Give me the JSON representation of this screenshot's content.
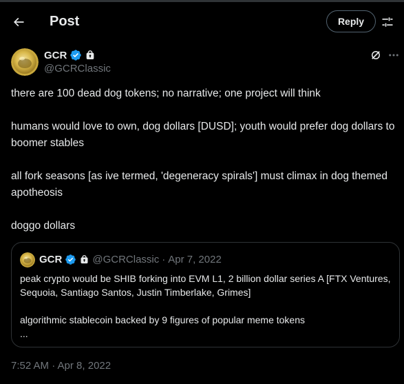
{
  "header": {
    "title": "Post",
    "reply_label": "Reply"
  },
  "tweet": {
    "display_name": "GCR",
    "handle": "@GCRClassic",
    "paragraphs": [
      "there are 100 dead dog tokens;  no narrative;  one project will think",
      "humans would love to own, dog dollars [DUSD];  youth would prefer dog dollars to boomer stables",
      "all fork seasons [as ive termed, 'degeneracy spirals'] must climax in dog themed apotheosis",
      "doggo dollars"
    ],
    "timestamp": "7:52 AM · Apr 8, 2022"
  },
  "quote": {
    "display_name": "GCR",
    "handle": "@GCRClassic",
    "separator": "·",
    "date": "Apr 7, 2022",
    "paragraphs": [
      "peak crypto would be SHIB forking into EVM L1, 2 billion dollar series A [FTX Ventures, Sequoia, Santiago Santos, Justin Timberlake, Grimes]",
      "algorithmic stablecoin backed by 9 figures of popular meme tokens\n..."
    ]
  },
  "colors": {
    "background": "#000000",
    "text": "#e7e9ea",
    "secondary": "#71767b",
    "border": "#2f3336",
    "verified": "#1d9bf0",
    "avatar_gold": "#d9b84a"
  },
  "icons": {
    "back": "arrow-left-icon",
    "settings": "sliders-icon",
    "verified": "verified-badge-icon",
    "lock": "lock-icon",
    "grok": "grok-icon",
    "more": "more-horizontal-icon"
  }
}
